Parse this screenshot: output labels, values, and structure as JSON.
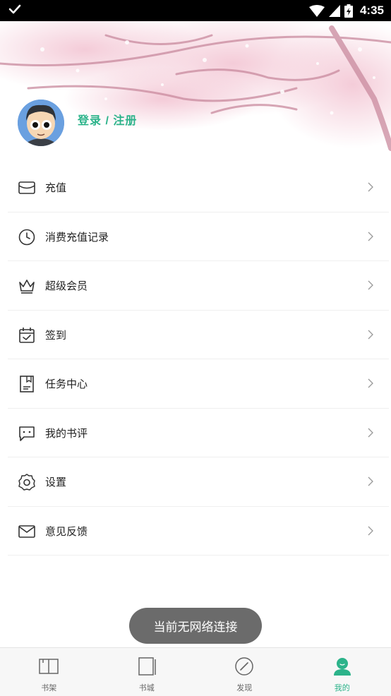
{
  "status_bar": {
    "time": "4:35"
  },
  "profile": {
    "login_label": "登录 / 注册"
  },
  "menu": [
    {
      "label": "充值",
      "icon": "wallet-icon"
    },
    {
      "label": "消费充值记录",
      "icon": "clock-icon"
    },
    {
      "label": "超级会员",
      "icon": "crown-icon"
    },
    {
      "label": "签到",
      "icon": "calendar-check-icon"
    },
    {
      "label": "任务中心",
      "icon": "task-document-icon"
    },
    {
      "label": "我的书评",
      "icon": "comment-bubble-icon"
    },
    {
      "label": "设置",
      "icon": "gear-icon"
    },
    {
      "label": "意见反馈",
      "icon": "envelope-icon"
    }
  ],
  "toast": {
    "text": "当前无网络连接"
  },
  "tabbar": {
    "active": "我的",
    "tabs": [
      {
        "label": "书架",
        "icon": "open-book-icon"
      },
      {
        "label": "书城",
        "icon": "bookstore-icon"
      },
      {
        "label": "发现",
        "icon": "compass-icon"
      },
      {
        "label": "我的",
        "icon": "user-icon"
      }
    ]
  },
  "colors": {
    "accent": "#2cb38a",
    "toast_bg": "#6b6b6b",
    "text": "#222222"
  }
}
